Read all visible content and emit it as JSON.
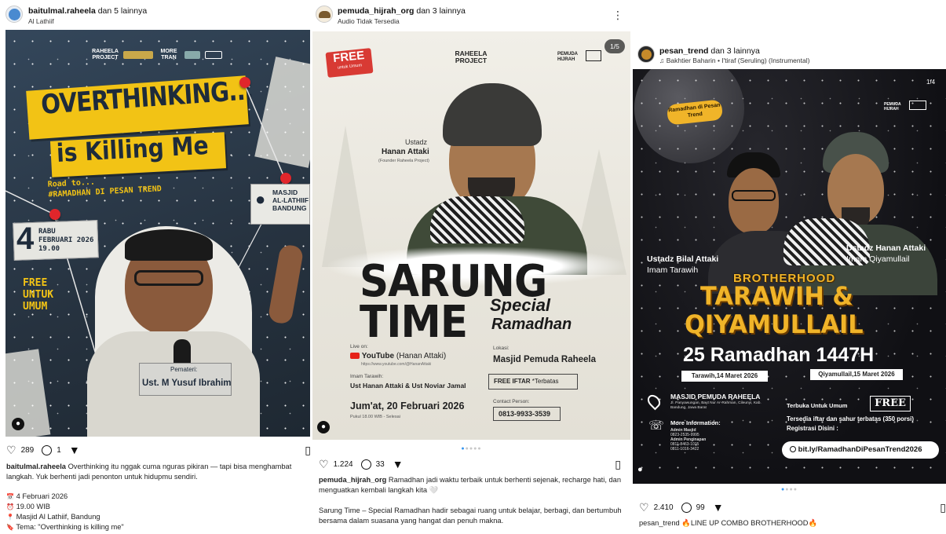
{
  "posts": [
    {
      "author": "baitulmal.raheela",
      "collab": "dan 5 lainnya",
      "subtitle": "Al Lathiif",
      "logos": [
        "RAHEELA PROJECT",
        "MORE TRAN"
      ],
      "poster": {
        "headline_1": "OVERTHINKING...",
        "headline_2": "is Killing Me",
        "road_to_1": "Road to...",
        "road_to_2": "#RAMADHAN DI PESAN TREND",
        "venue_1": "MASJID",
        "venue_2": "AL-LATHIIF",
        "venue_3": "BANDUNG",
        "day": "4",
        "day_label": "RABU",
        "month": "FEBRUARI 2026",
        "time": "19.00",
        "free_1": "FREE",
        "free_2": "UNTUK",
        "free_3": "UMUM",
        "speaker_label": "Pemateri:",
        "speaker": "Ust. M Yusuf Ibrahim"
      },
      "likes": "289",
      "comments": "1",
      "caption_user": "baitulmal.raheela",
      "caption_text": "Overthinking itu nggak cuma nguras pikiran — tapi bisa menghambat langkah. Yuk berhenti jadi penonton untuk hidupmu sendiri.",
      "details": [
        {
          "icon": "calendar-icon",
          "glyph": "📅",
          "text": "4 Februari 2026"
        },
        {
          "icon": "clock-icon",
          "glyph": "⏰",
          "text": "19.00 WIB"
        },
        {
          "icon": "pin-icon",
          "glyph": "📍",
          "text": "Masjid Al Lathiif, Bandung"
        },
        {
          "icon": "tag-icon",
          "glyph": "🔖",
          "text": "Tema: \"Overthinking is killing me\""
        }
      ]
    },
    {
      "author": "pemuda_hijrah_org",
      "collab": "dan 3 lainnya",
      "subtitle": "Audio Tidak Tersedia",
      "more": "⋮",
      "logos": [
        "RAHEELA PROJECT",
        "PEMUDA HIJRAH"
      ],
      "page_indicator": "1/5",
      "poster": {
        "free": "FREE",
        "free_sub": "untuk Umum",
        "ustadz_label": "Ustadz",
        "ustadz_name": "Hanan Attaki",
        "ustadz_role": "(Founder Raheela Project)",
        "title_1": "SARUNG",
        "title_2": "TIME",
        "special_1": "Special",
        "special_2": "Ramadhan",
        "live_on": "Live on:",
        "youtube": "YouTube",
        "youtube_channel": "(Hanan Attaki)",
        "youtube_url": "https://www.youtube.com/@HananAttaki",
        "imam_label": "Imam Tarawih:",
        "imam_names": "Ust Hanan Attaki & Ust Noviar Jamal",
        "date": "Jum'at, 20 Februari 2026",
        "time": "Pukul 18.00 WIB - Selesai",
        "lokasi_label": "Lokasi:",
        "lokasi": "Masjid Pemuda Raheela",
        "iftar": "FREE IFTAR",
        "iftar_note": "*Terbatas",
        "contact_label": "Contact Person:",
        "contact": "0813-9933-3539"
      },
      "likes": "1.224",
      "comments": "33",
      "caption_user": "pemuda_hijrah_org",
      "caption_text": "Ramadhan jadi waktu terbaik untuk berhenti sejenak, recharge hati, dan menguatkan kembali langkah kita 🤍",
      "caption_text_2": "Sarung Time – Special Ramadhan hadir sebagai ruang untuk belajar, berbagi, dan bertumbuh bersama dalam suasana yang hangat dan penuh makna."
    },
    {
      "author": "pesan_trend",
      "collab": "dan 3 lainnya",
      "subtitle": "Bakhtier Baharin • I'tiraf (Seruling) (Instrumental)",
      "logos": [
        "Ramadhan di Pesan Trend",
        "PEMUDA HIJRAH"
      ],
      "page_indicator": "1/4",
      "poster": {
        "left_name": "Ustadz Bilal Attaki",
        "left_role": "Imam Tarawih",
        "right_name": "Ustadz Hanan Attaki",
        "right_role": "Imam Qiyamullail",
        "brotherhood": "BROTHERHOOD",
        "title_1": "TARAWIH &",
        "title_2": "QIYAMULLAIL",
        "date_big": "25 Ramadhan 1447H",
        "tarawih_date": "Tarawih,14 Maret 2026",
        "qiyam_date": "Qiyamullail,15 Maret 2026",
        "masjid": "MASJID PEMUDA RAHEELA",
        "address": "Jl. Panyawungan, Bayt Nur Ar-Rahman, Cileunyi, Kab. Bandung, Jawa Barat",
        "more_info": "More Information:",
        "admin_masjid": "Admin Masjid",
        "admin_masjid_no": "0823-2535-9995",
        "admin_inap": "Admin Penginapan",
        "admin_inap_no_1": "0811-8463-1015",
        "admin_inap_no_2": "0811-1016-3422",
        "terbuka": "Terbuka Untuk Umum",
        "free": "FREE",
        "iftar": "Tersedia iftar dan sahur terbatas (350 porsi)",
        "registrasi": "Registrasi Disini :",
        "link": "bit.ly/RamadhanDiPesanTrend2026"
      },
      "likes": "2.410",
      "comments": "99",
      "caption_user": "pesan_trend",
      "caption_text": "🔥LINE UP COMBO BROTHERHOOD🔥"
    }
  ],
  "colors": {
    "p1_bg": "#2b3a4a",
    "p1_yellow": "#f2c315",
    "p2_bg": "#ebe8df",
    "p2_red": "#d83a34",
    "p3_bg": "#141418",
    "p3_gold": "#f0b429",
    "ig_blue": "#3897f0"
  }
}
